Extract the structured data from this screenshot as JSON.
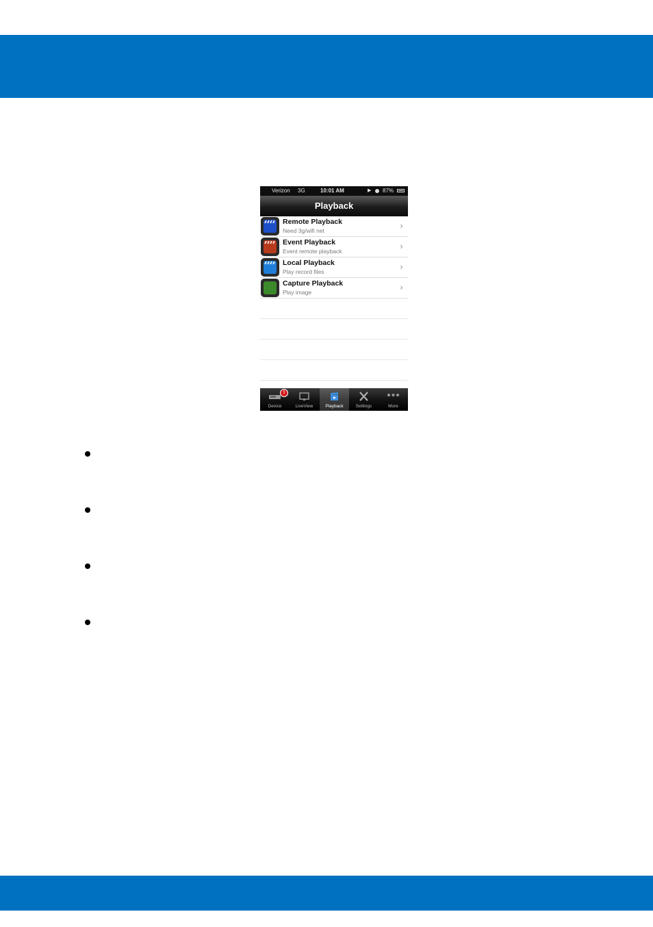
{
  "status_bar": {
    "carrier": "Verizon",
    "network": "3G",
    "time": "10:01 AM",
    "battery": "87%"
  },
  "nav": {
    "title": "Playback"
  },
  "items": [
    {
      "title": "Remote Playback",
      "subtitle": "Need 3g/wifi net",
      "icon": "remote-playback-icon",
      "color": "#1f4fc8"
    },
    {
      "title": "Event Playback",
      "subtitle": "Event remote playback",
      "icon": "event-playback-icon",
      "color": "#b83a1c"
    },
    {
      "title": "Local Playback",
      "subtitle": "Play record files",
      "icon": "local-playback-icon",
      "color": "#1f7fd8"
    },
    {
      "title": "Capture Playback",
      "subtitle": "Play image",
      "icon": "capture-playback-icon",
      "color": "#3c8a2c"
    }
  ],
  "tabs": [
    {
      "label": "Device",
      "icon": "device-icon"
    },
    {
      "label": "LiveView",
      "icon": "monitor-icon"
    },
    {
      "label": "Playback",
      "icon": "playback-icon",
      "active": true
    },
    {
      "label": "Settings",
      "icon": "settings-icon"
    },
    {
      "label": "More",
      "icon": "more-icon"
    }
  ],
  "colors": {
    "band": "#0071c1",
    "badge": "#d21d1d"
  }
}
